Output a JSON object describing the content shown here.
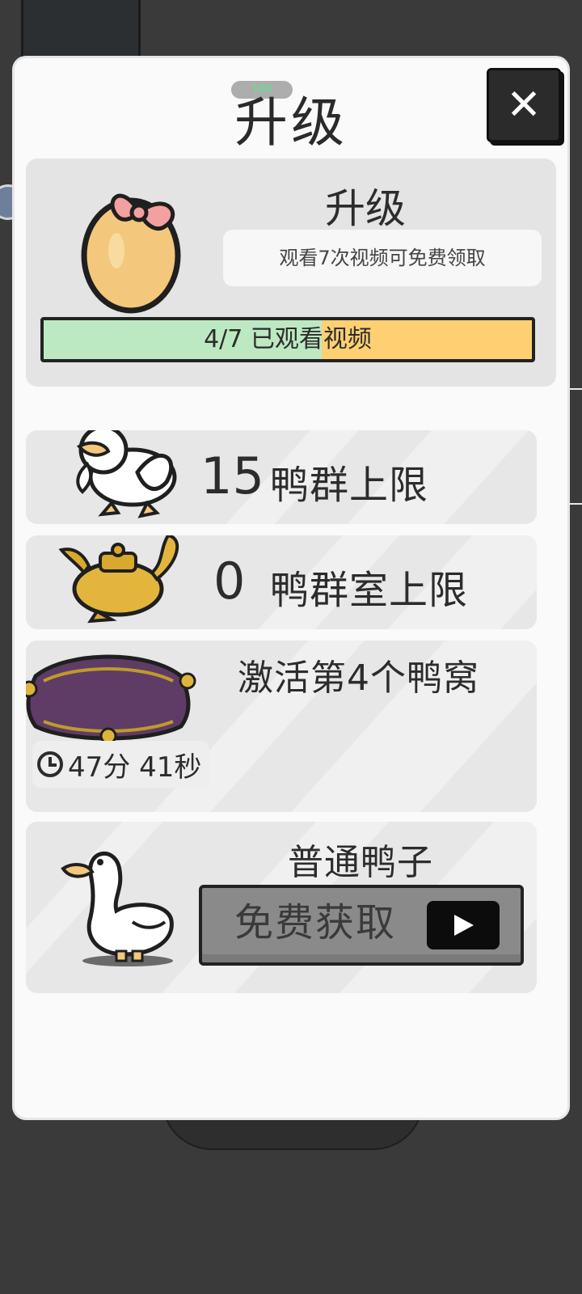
{
  "title": "升级",
  "title_pill": "160",
  "close_label": "✕",
  "upgrade_card": {
    "heading": "升级",
    "description": "观看7次视频可免费领取",
    "progress_watched": 4,
    "progress_total": 7,
    "progress_fraction": 0.57,
    "progress_text": "4/7 已观看视频"
  },
  "flock_limit": {
    "value": "15",
    "label": "鸭群上限"
  },
  "room_limit": {
    "value": "0",
    "label": "鸭群室上限"
  },
  "activate_nest": {
    "label": "激活第4个鸭窝",
    "timer": "47分 41秒"
  },
  "normal_duck": {
    "label": "普通鸭子",
    "button": "免费获取"
  },
  "colors": {
    "progress_green": "#bde9c2",
    "progress_yellow": "#ffd071",
    "card_bg": "#e7e7e7"
  }
}
